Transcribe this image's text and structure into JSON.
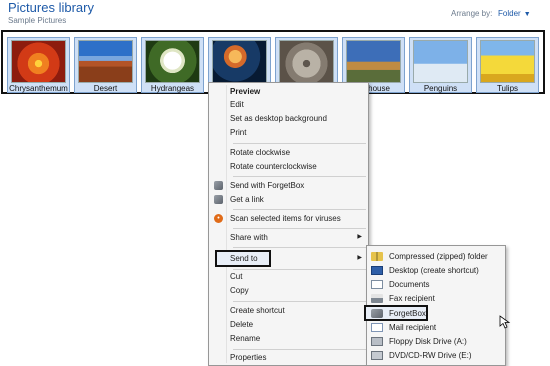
{
  "library": {
    "title": "Pictures library",
    "subtitle": "Sample Pictures",
    "arrange_label": "Arrange by:",
    "arrange_value": "Folder"
  },
  "thumbnails": [
    {
      "label": "Chrysanthemum"
    },
    {
      "label": "Desert"
    },
    {
      "label": "Hydrangeas"
    },
    {
      "label": ""
    },
    {
      "label": ""
    },
    {
      "label": "ghthouse"
    },
    {
      "label": "Penguins"
    },
    {
      "label": "Tulips"
    }
  ],
  "context_menu": {
    "preview": "Preview",
    "edit": "Edit",
    "set_desktop_bg": "Set as desktop background",
    "print": "Print",
    "rotate_cw": "Rotate clockwise",
    "rotate_ccw": "Rotate counterclockwise",
    "send_forgetbox": "Send with ForgetBox",
    "get_link": "Get a link",
    "scan": "Scan selected items for viruses",
    "share_with": "Share with",
    "send_to": "Send to",
    "cut": "Cut",
    "copy": "Copy",
    "create_shortcut": "Create shortcut",
    "delete": "Delete",
    "rename": "Rename",
    "properties": "Properties"
  },
  "send_to_menu": {
    "compressed": "Compressed (zipped) folder",
    "desktop": "Desktop (create shortcut)",
    "documents": "Documents",
    "fax": "Fax recipient",
    "forgetbox": "ForgetBox",
    "mail": "Mail recipient",
    "floppy": "Floppy Disk Drive (A:)",
    "dvd": "DVD/CD-RW Drive (E:)"
  },
  "colors": {
    "title_blue": "#1e5aa8",
    "menu_background": "#f5f5f5",
    "highlight_border": "#111111"
  }
}
